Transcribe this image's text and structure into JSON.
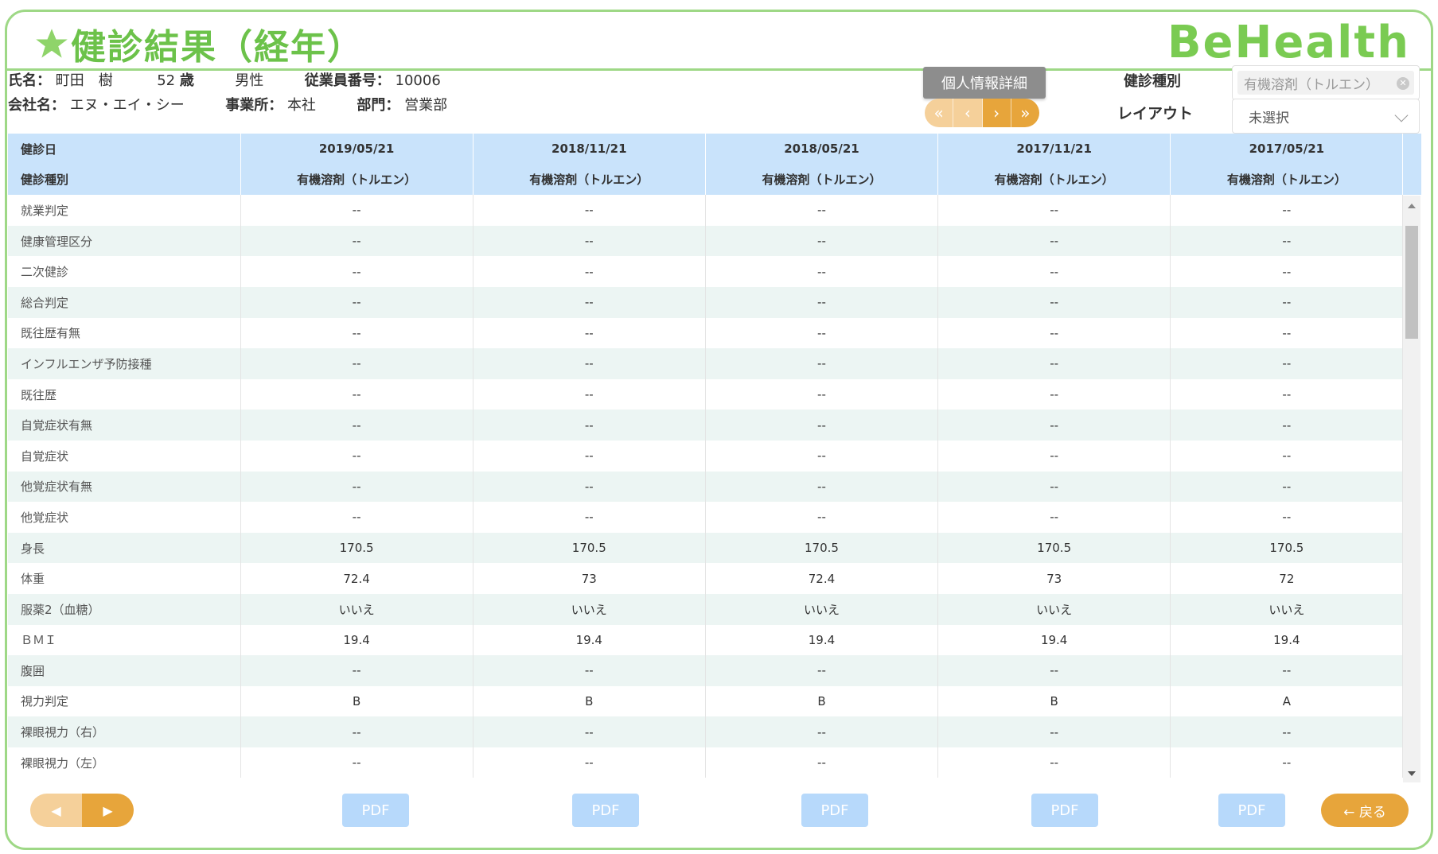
{
  "header": {
    "title": "健診結果（経年）",
    "logo": "BeHealth"
  },
  "employee": {
    "name_label": "氏名：",
    "name": "町田　樹",
    "age": "52",
    "age_unit": "歳",
    "gender": "男性",
    "id_label": "従業員番号：",
    "id": "10006",
    "company_label": "会社名：",
    "company": "エヌ・エイ・シー",
    "office_label": "事業所：",
    "office": "本社",
    "dept_label": "部門：",
    "dept": "営業部"
  },
  "controls": {
    "detail_button": "個人情報詳細",
    "pager": {
      "first": "«",
      "prev": "‹",
      "next": "›",
      "last": "»"
    },
    "kind_label": "健診種別",
    "kind_value": "有機溶剤（トルエン）",
    "layout_label": "レイアウト",
    "layout_value": "未選択"
  },
  "table": {
    "date_label": "健診日",
    "kind_label": "健診種別",
    "dates": [
      "2019/05/21",
      "2018/11/21",
      "2018/05/21",
      "2017/11/21",
      "2017/05/21"
    ],
    "kinds": [
      "有機溶剤（トルエン）",
      "有機溶剤（トルエン）",
      "有機溶剤（トルエン）",
      "有機溶剤（トルエン）",
      "有機溶剤（トルエン）"
    ],
    "rows": [
      {
        "label": "就業判定",
        "values": [
          "--",
          "--",
          "--",
          "--",
          "--"
        ]
      },
      {
        "label": "健康管理区分",
        "values": [
          "--",
          "--",
          "--",
          "--",
          "--"
        ]
      },
      {
        "label": "二次健診",
        "values": [
          "--",
          "--",
          "--",
          "--",
          "--"
        ]
      },
      {
        "label": "総合判定",
        "values": [
          "--",
          "--",
          "--",
          "--",
          "--"
        ]
      },
      {
        "label": "既往歴有無",
        "values": [
          "--",
          "--",
          "--",
          "--",
          "--"
        ]
      },
      {
        "label": "インフルエンザ予防接種",
        "values": [
          "--",
          "--",
          "--",
          "--",
          "--"
        ]
      },
      {
        "label": "既往歴",
        "values": [
          "--",
          "--",
          "--",
          "--",
          "--"
        ]
      },
      {
        "label": "自覚症状有無",
        "values": [
          "--",
          "--",
          "--",
          "--",
          "--"
        ]
      },
      {
        "label": "自覚症状",
        "values": [
          "--",
          "--",
          "--",
          "--",
          "--"
        ]
      },
      {
        "label": "他覚症状有無",
        "values": [
          "--",
          "--",
          "--",
          "--",
          "--"
        ]
      },
      {
        "label": "他覚症状",
        "values": [
          "--",
          "--",
          "--",
          "--",
          "--"
        ]
      },
      {
        "label": "身長",
        "values": [
          "170.5",
          "170.5",
          "170.5",
          "170.5",
          "170.5"
        ]
      },
      {
        "label": "体重",
        "values": [
          "72.4",
          "73",
          "72.4",
          "73",
          "72"
        ]
      },
      {
        "label": "服薬2（血糖）",
        "values": [
          "いいえ",
          "いいえ",
          "いいえ",
          "いいえ",
          "いいえ"
        ]
      },
      {
        "label": "ＢＭＩ",
        "values": [
          "19.4",
          "19.4",
          "19.4",
          "19.4",
          "19.4"
        ]
      },
      {
        "label": "腹囲",
        "values": [
          "--",
          "--",
          "--",
          "--",
          "--"
        ]
      },
      {
        "label": "視力判定",
        "values": [
          "B",
          "B",
          "B",
          "B",
          "A"
        ]
      },
      {
        "label": "裸眼視力（右）",
        "values": [
          "--",
          "--",
          "--",
          "--",
          "--"
        ]
      },
      {
        "label": "裸眼視力（左）",
        "values": [
          "--",
          "--",
          "--",
          "--",
          "--"
        ]
      }
    ]
  },
  "footer": {
    "prev": "◀",
    "next": "▶",
    "pdf_label": "PDF",
    "back": "← 戻る"
  }
}
